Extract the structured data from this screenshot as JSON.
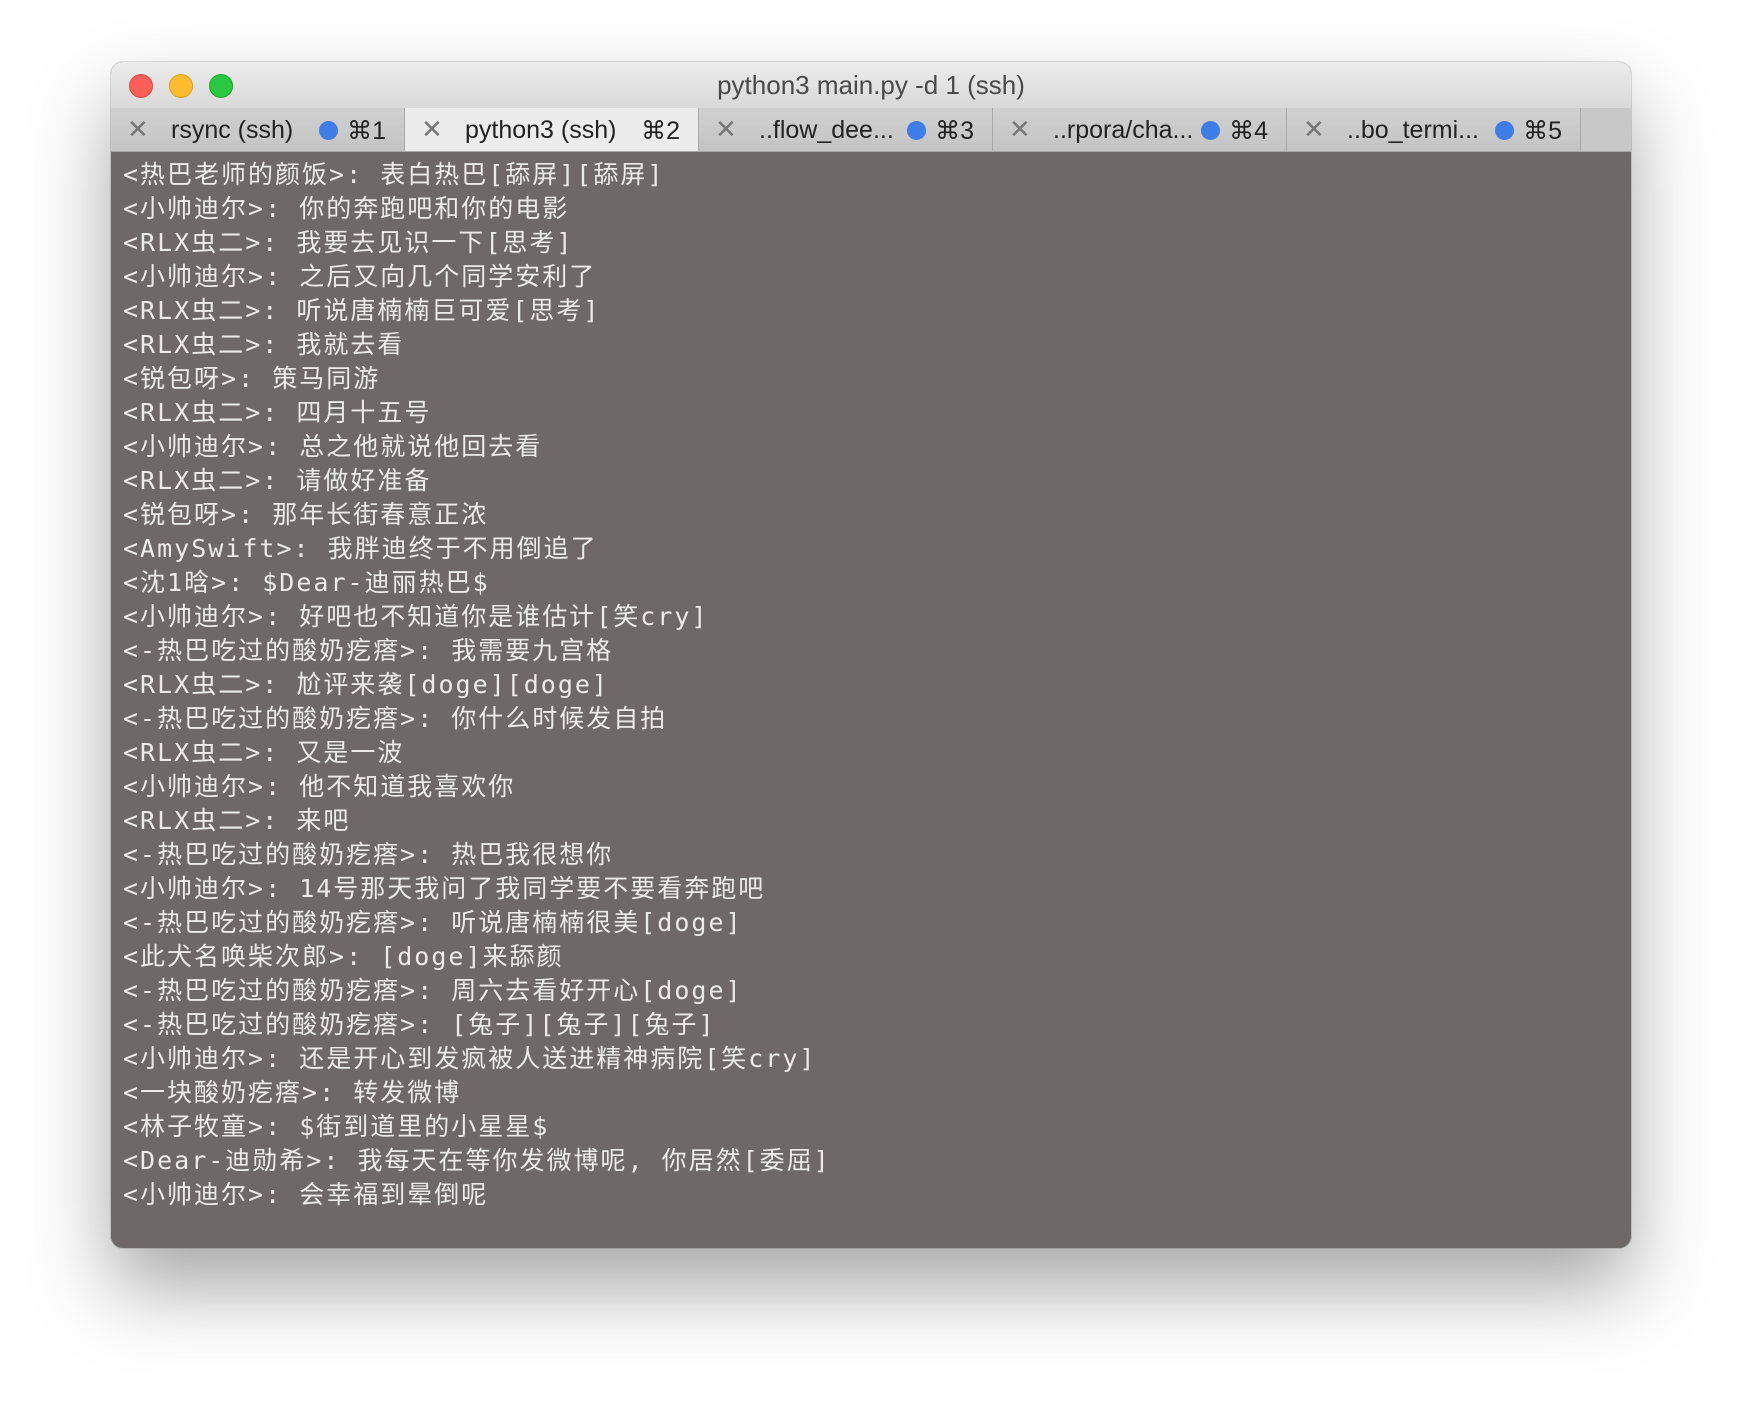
{
  "window": {
    "title": "python3 main.py -d 1 (ssh)"
  },
  "tabs": [
    {
      "label": "rsync (ssh)",
      "shortcut": "⌘1",
      "active": false,
      "has_activity_dot": true
    },
    {
      "label": "python3 (ssh)",
      "shortcut": "⌘2",
      "active": true,
      "has_activity_dot": false
    },
    {
      "label": "..flow_dee...",
      "shortcut": "⌘3",
      "active": false,
      "has_activity_dot": true
    },
    {
      "label": "..rpora/cha...",
      "shortcut": "⌘4",
      "active": false,
      "has_activity_dot": true
    },
    {
      "label": "..bo_termi...",
      "shortcut": "⌘5",
      "active": false,
      "has_activity_dot": true
    }
  ],
  "terminal": {
    "lines": [
      "<热巴老师的颜饭>: 表白热巴[舔屏][舔屏]",
      "<小帅迪尔>: 你的奔跑吧和你的电影",
      "<RLX虫二>: 我要去见识一下[思考]",
      "<小帅迪尔>: 之后又向几个同学安利了",
      "<RLX虫二>: 听说唐楠楠巨可爱[思考]",
      "<RLX虫二>: 我就去看",
      "<锐包呀>: 策马同游",
      "<RLX虫二>: 四月十五号",
      "<小帅迪尔>: 总之他就说他回去看",
      "<RLX虫二>: 请做好准备",
      "<锐包呀>: 那年长街春意正浓",
      "<AmySwift>: 我胖迪终于不用倒追了",
      "<沈1晗>: $Dear-迪丽热巴$",
      "<小帅迪尔>: 好吧也不知道你是谁估计[笑cry]",
      "<-热巴吃过的酸奶疙瘩>: 我需要九宫格",
      "<RLX虫二>: 尬评来袭[doge][doge]",
      "<-热巴吃过的酸奶疙瘩>: 你什么时候发自拍",
      "<RLX虫二>: 又是一波",
      "<小帅迪尔>: 他不知道我喜欢你",
      "<RLX虫二>: 来吧",
      "<-热巴吃过的酸奶疙瘩>: 热巴我很想你",
      "<小帅迪尔>: 14号那天我问了我同学要不要看奔跑吧",
      "<-热巴吃过的酸奶疙瘩>: 听说唐楠楠很美[doge]",
      "<此犬名唤柴次郎>: [doge]来舔颜",
      "<-热巴吃过的酸奶疙瘩>: 周六去看好开心[doge]",
      "<-热巴吃过的酸奶疙瘩>: [兔子][兔子][兔子]",
      "<小帅迪尔>: 还是开心到发疯被人送进精神病院[笑cry]",
      "<一块酸奶疙瘩>: 转发微博",
      "<林子牧童>: $街到道里的小星星$",
      "<Dear-迪勋希>: 我每天在等你发微博呢, 你居然[委屈]",
      "<小帅迪尔>: 会幸福到晕倒呢"
    ]
  },
  "colors": {
    "terminal_bg": "#6e6966",
    "terminal_fg": "#ecebea",
    "activity_dot": "#3f7de8",
    "close_button": "#fc5f57",
    "minimize_button": "#fdbc2e",
    "maximize_button": "#29c840"
  }
}
